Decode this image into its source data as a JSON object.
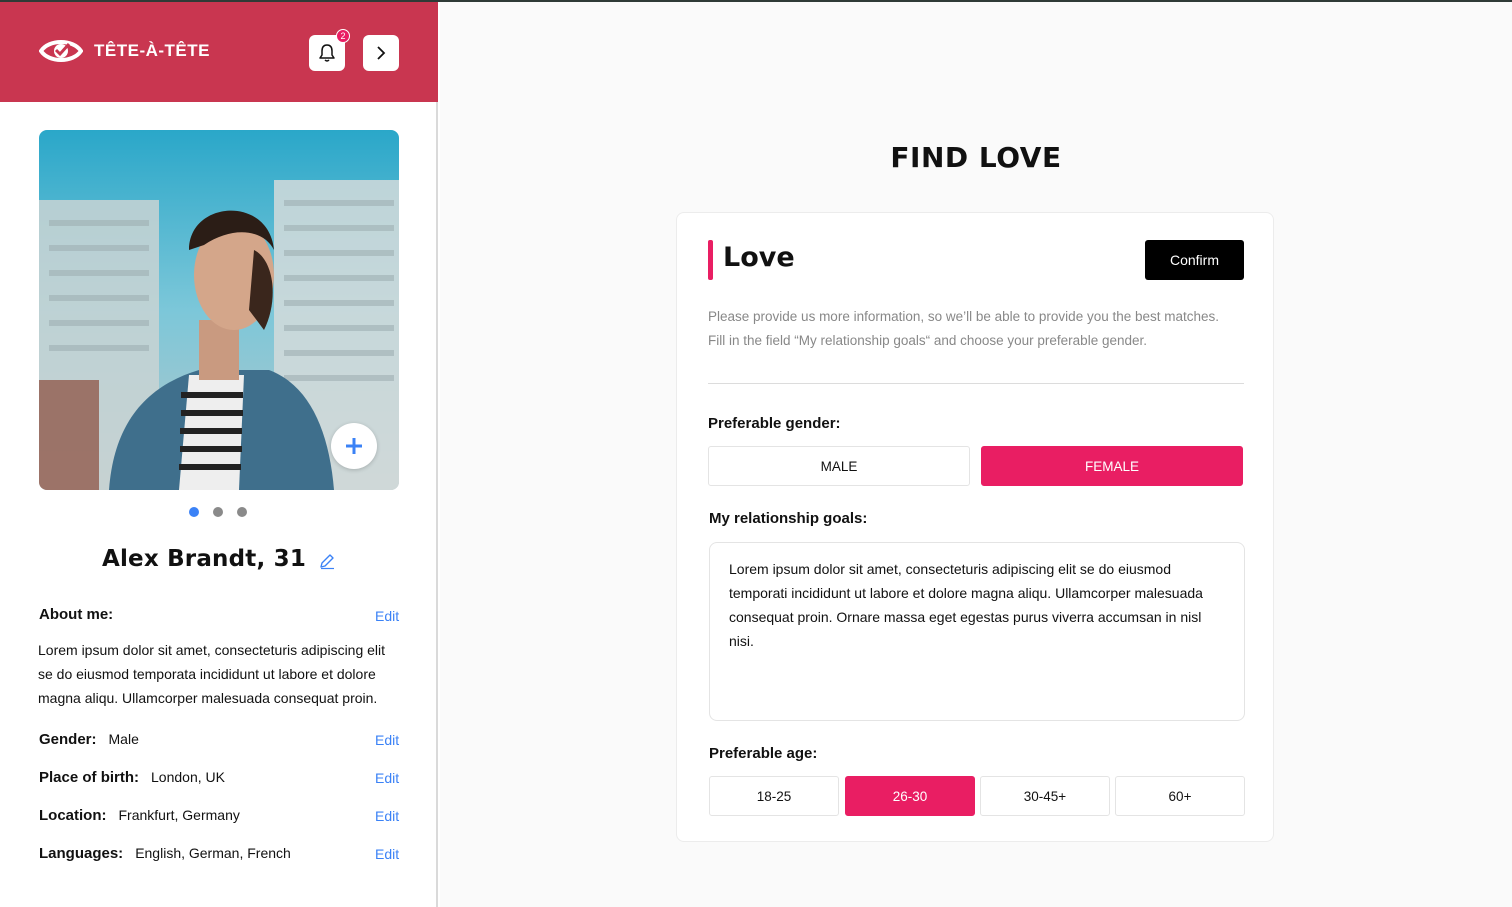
{
  "app": {
    "brand": "TÊTE-À-TÊTE",
    "notification_count": "2"
  },
  "colors": {
    "header": "#c93650",
    "accent": "#e91e63",
    "link": "#3b82f6"
  },
  "profile": {
    "name": "Alex Brandt, 31",
    "photo_carousel": {
      "count": 3,
      "active_index": 0
    },
    "about_label": "About me:",
    "about_text": "Lorem ipsum dolor sit amet, consecteturis adipiscing elit se do eiusmod temporata incididunt ut labore et dolore magna aliqu. Ullamcorper malesuada consequat proin.",
    "edit_label": "Edit",
    "fields": [
      {
        "label": "Gender:",
        "value": "Male"
      },
      {
        "label": "Place of birth:",
        "value": "London, UK"
      },
      {
        "label": "Location:",
        "value": "Frankfurt, Germany"
      },
      {
        "label": "Languages:",
        "value": "English, German, French"
      }
    ]
  },
  "main": {
    "title": "FIND LOVE",
    "card": {
      "title": "Love",
      "confirm_label": "Confirm",
      "description_line1": "Please provide us more information, so we’ll be able to provide you the best matches.",
      "description_line2": "Fill in the field “My relationship goals“ and choose your preferable gender.",
      "gender_label": "Preferable gender:",
      "gender_options": [
        {
          "label": "MALE",
          "selected": false
        },
        {
          "label": "FEMALE",
          "selected": true
        }
      ],
      "goals_label": "My relationship goals:",
      "goals_text": "Lorem ipsum dolor sit amet, consecteturis adipiscing elit se do eiusmod temporati incididunt ut labore et dolore magna aliqu. Ullamcorper malesuada consequat proin. Ornare massa eget egestas purus viverra accumsan in nisl nisi.",
      "age_label": "Preferable age:",
      "age_options": [
        {
          "label": "18-25",
          "selected": false
        },
        {
          "label": "26-30",
          "selected": true
        },
        {
          "label": "30-45+",
          "selected": false
        },
        {
          "label": "60+",
          "selected": false
        }
      ]
    }
  }
}
